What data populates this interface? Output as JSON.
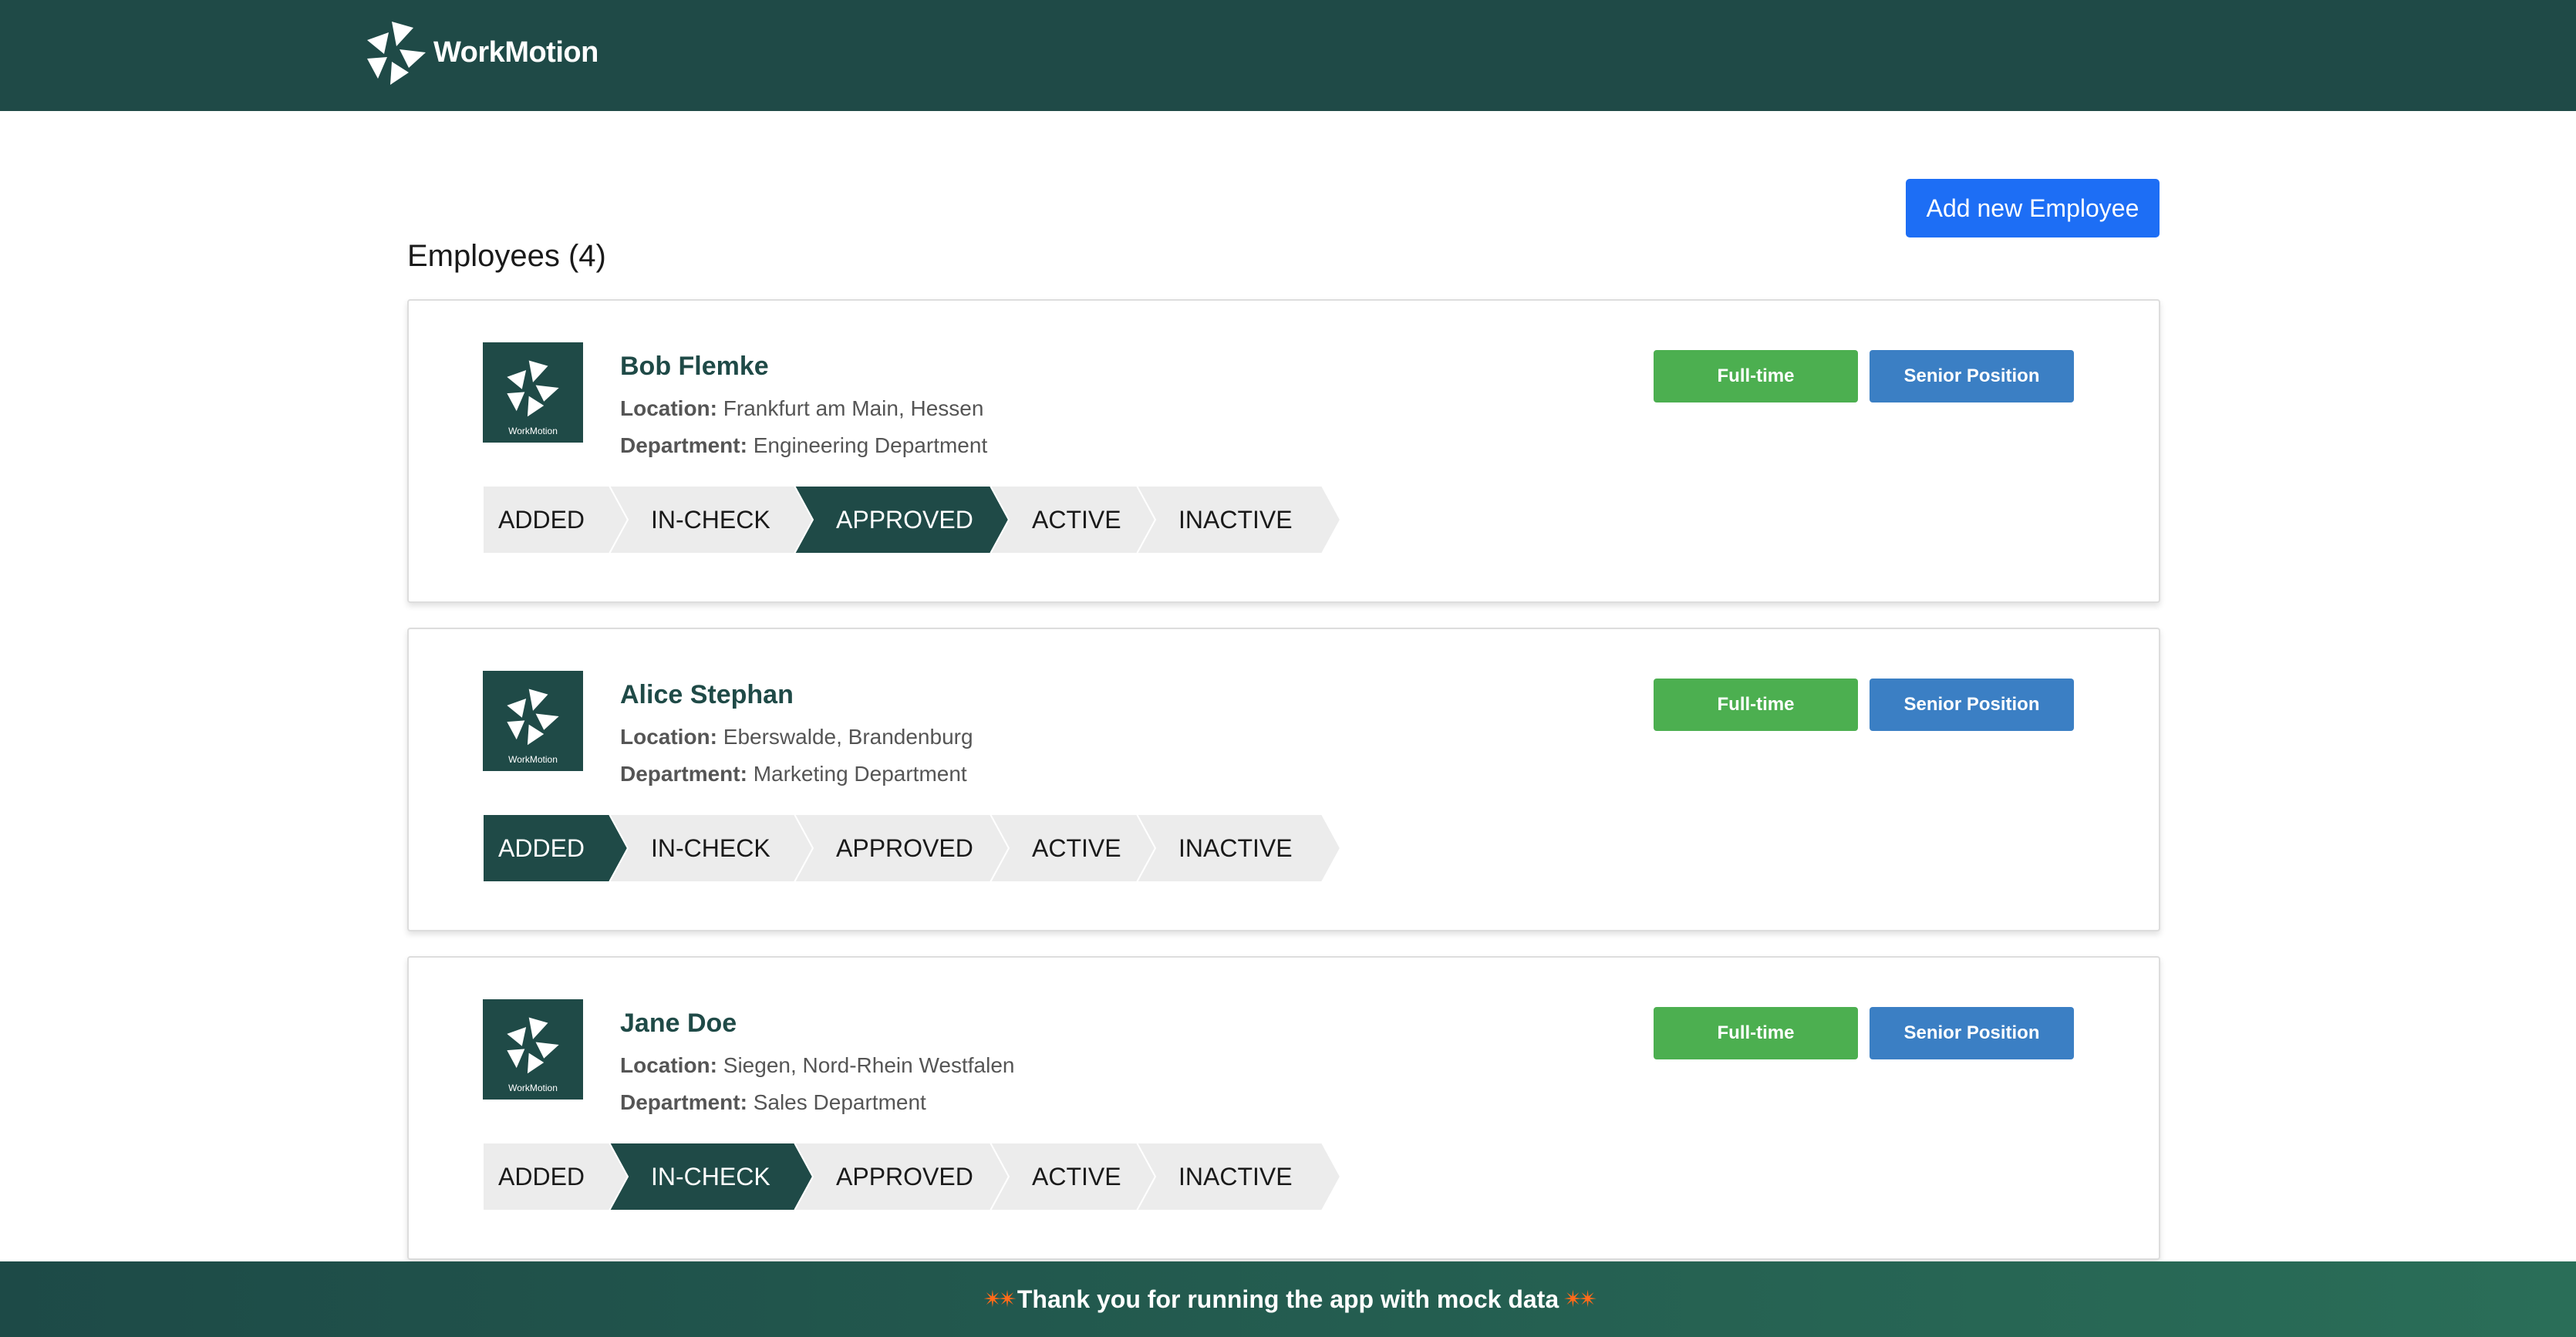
{
  "header": {
    "logo_text": "WorkMotion",
    "logo_icon": "workmotion-logo-icon"
  },
  "actions": {
    "add_employee_label": "Add new Employee"
  },
  "list": {
    "title": "Employees (4)"
  },
  "step_labels": [
    "ADDED",
    "IN-CHECK",
    "APPROVED",
    "ACTIVE",
    "INACTIVE"
  ],
  "employees": [
    {
      "name": "Bob Flemke",
      "location_label": "Location:",
      "location": "Frankfurt am Main, Hessen",
      "department_label": "Department:",
      "department": "Engineering Department",
      "avatar_caption": "WorkMotion",
      "badges": [
        "Full-time",
        "Senior Position"
      ],
      "current_state": "APPROVED"
    },
    {
      "name": "Alice Stephan",
      "location_label": "Location:",
      "location": "Eberswalde, Brandenburg",
      "department_label": "Department:",
      "department": "Marketing Department",
      "avatar_caption": "WorkMotion",
      "badges": [
        "Full-time",
        "Senior Position"
      ],
      "current_state": "ADDED"
    },
    {
      "name": "Jane Doe",
      "location_label": "Location:",
      "location": "Siegen, Nord-Rhein Westfalen",
      "department_label": "Department:",
      "department": "Sales Department",
      "avatar_caption": "WorkMotion",
      "badges": [
        "Full-time",
        "Senior Position"
      ],
      "current_state": "IN-CHECK"
    }
  ],
  "footer": {
    "message": "Thank you for running the app with mock data",
    "icon": "sparkle-emoji-icon"
  },
  "colors": {
    "brand_dark_green": "#1f4a47",
    "primary_blue": "#1d6ef5",
    "badge_green": "#4caf50",
    "badge_blue": "#3b7fc4",
    "step_inactive": "#ececec",
    "step_active": "#1f4a47"
  }
}
